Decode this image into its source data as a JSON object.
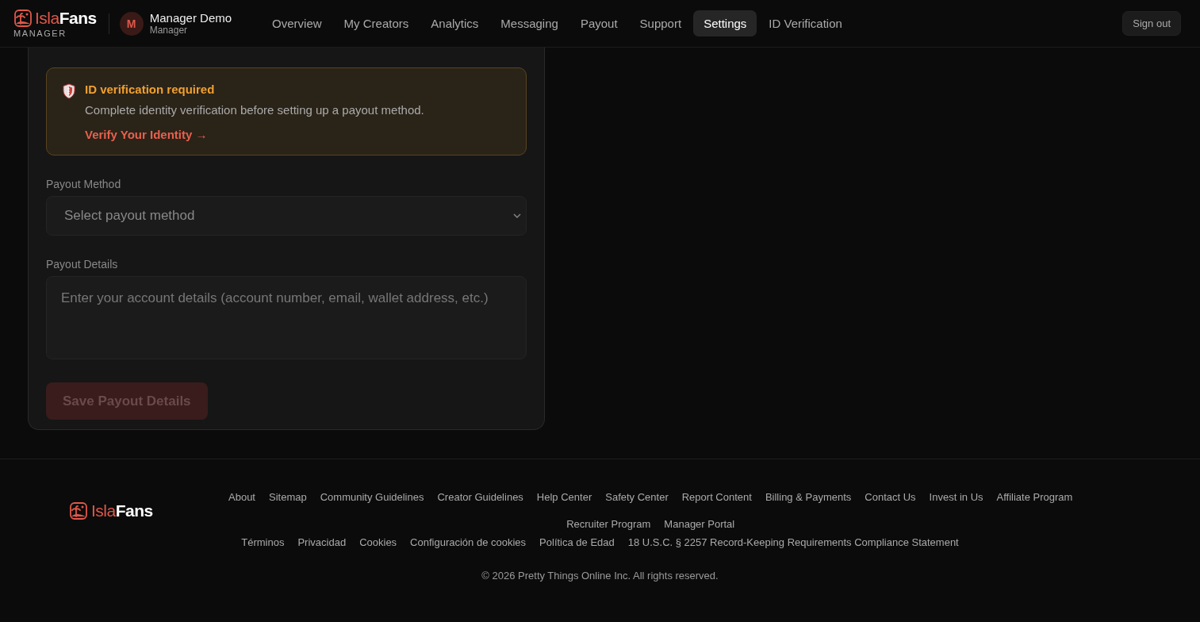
{
  "header": {
    "logo": {
      "part1": "Isla",
      "part2": "Fans"
    },
    "logo_sub": "MANAGER",
    "user": {
      "initial": "M",
      "name": "Manager Demo",
      "role": "Manager"
    },
    "nav": [
      {
        "label": "Overview",
        "selected": false
      },
      {
        "label": "My Creators",
        "selected": false
      },
      {
        "label": "Analytics",
        "selected": false
      },
      {
        "label": "Messaging",
        "selected": false
      },
      {
        "label": "Payout",
        "selected": false
      },
      {
        "label": "Support",
        "selected": false
      },
      {
        "label": "Settings",
        "selected": true
      },
      {
        "label": "ID Verification",
        "selected": false
      }
    ],
    "sign_out": "Sign out"
  },
  "card": {
    "alert": {
      "title": "ID verification required",
      "text": "Complete identity verification before setting up a payout method.",
      "link": "Verify Your Identity →"
    },
    "method": {
      "label": "Payout Method",
      "placeholder": "Select payout method"
    },
    "details": {
      "label": "Payout Details",
      "placeholder": "Enter your account details (account number, email, wallet address, etc.)"
    },
    "save": {
      "label": "Save Payout Details",
      "disabled": true
    }
  },
  "footer": {
    "logo": {
      "part1": "Isla",
      "part2": "Fans"
    },
    "links": [
      "About",
      "Sitemap",
      "Community Guidelines",
      "Creator Guidelines",
      "Help Center",
      "Safety Center",
      "Report Content",
      "Billing & Payments",
      "Contact Us",
      "Invest in Us",
      "Affiliate Program",
      "Recruiter Program",
      "Manager Portal"
    ],
    "legal": [
      "Términos",
      "Privacidad",
      "Cookies",
      "Configuración de cookies",
      "Política de Edad",
      "18 U.S.C. § 2257 Record-Keeping Requirements Compliance Statement"
    ],
    "copyright": "© 2026 Pretty Things Online Inc. All rights reserved."
  }
}
